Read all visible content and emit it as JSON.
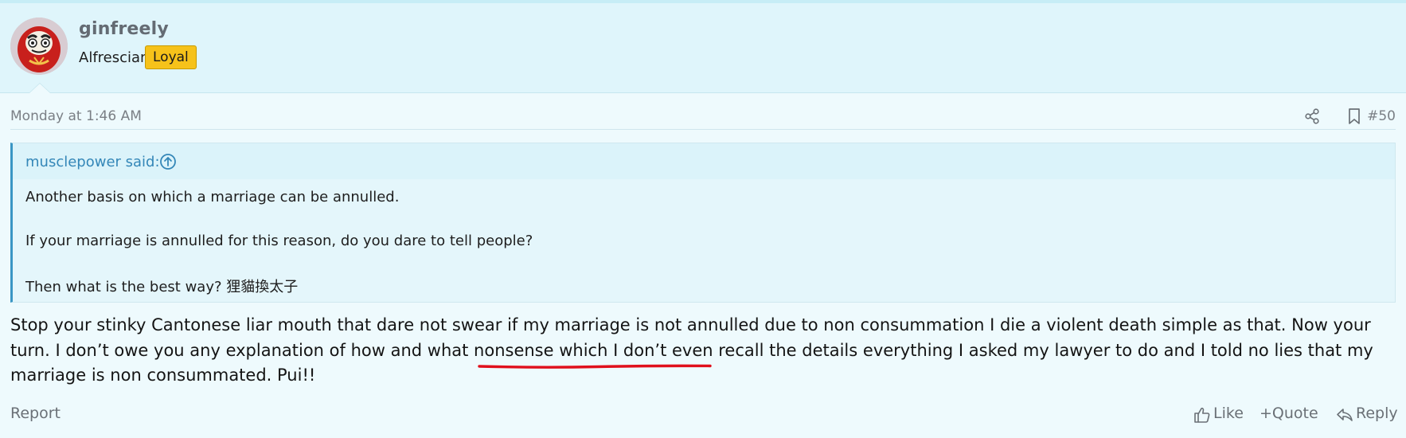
{
  "user": {
    "name": "ginfreely",
    "title": "Alfrescian",
    "badge": "Loyal",
    "avatar_icon": "daruma-avatar"
  },
  "post": {
    "date": "Monday at 1:46 AM",
    "number": "#50",
    "share_icon": "share-icon",
    "bookmark_icon": "bookmark-icon"
  },
  "quote": {
    "author": "musclepower said:",
    "lines": [
      "Another basis on which a marriage can be annulled.",
      "If your marriage is annulled for this reason, do you dare to tell people?",
      "Then what is the best way? 狸貓換太子"
    ]
  },
  "body": {
    "part1": "Stop your stinky Cantonese liar mouth that dare not swear if my marriage is not annulled due to non consummation I die a violent death simple as that. Now your turn. I don’t owe you any explanation of how and what nonsense which ",
    "highlight": "I don’t even recall the details",
    "part2": " everything I asked my lawyer to do and I told no lies that my marriage is non consummated. Pui!!"
  },
  "footer": {
    "report": "Report",
    "like": "Like",
    "quote": "+Quote",
    "reply": "Reply"
  },
  "colors": {
    "header_bg": "#dff5fb",
    "page_bg": "#eefafd",
    "quote_border": "#3a96c4",
    "badge": "#f6c21a",
    "highlight_underline": "#e0101c"
  }
}
